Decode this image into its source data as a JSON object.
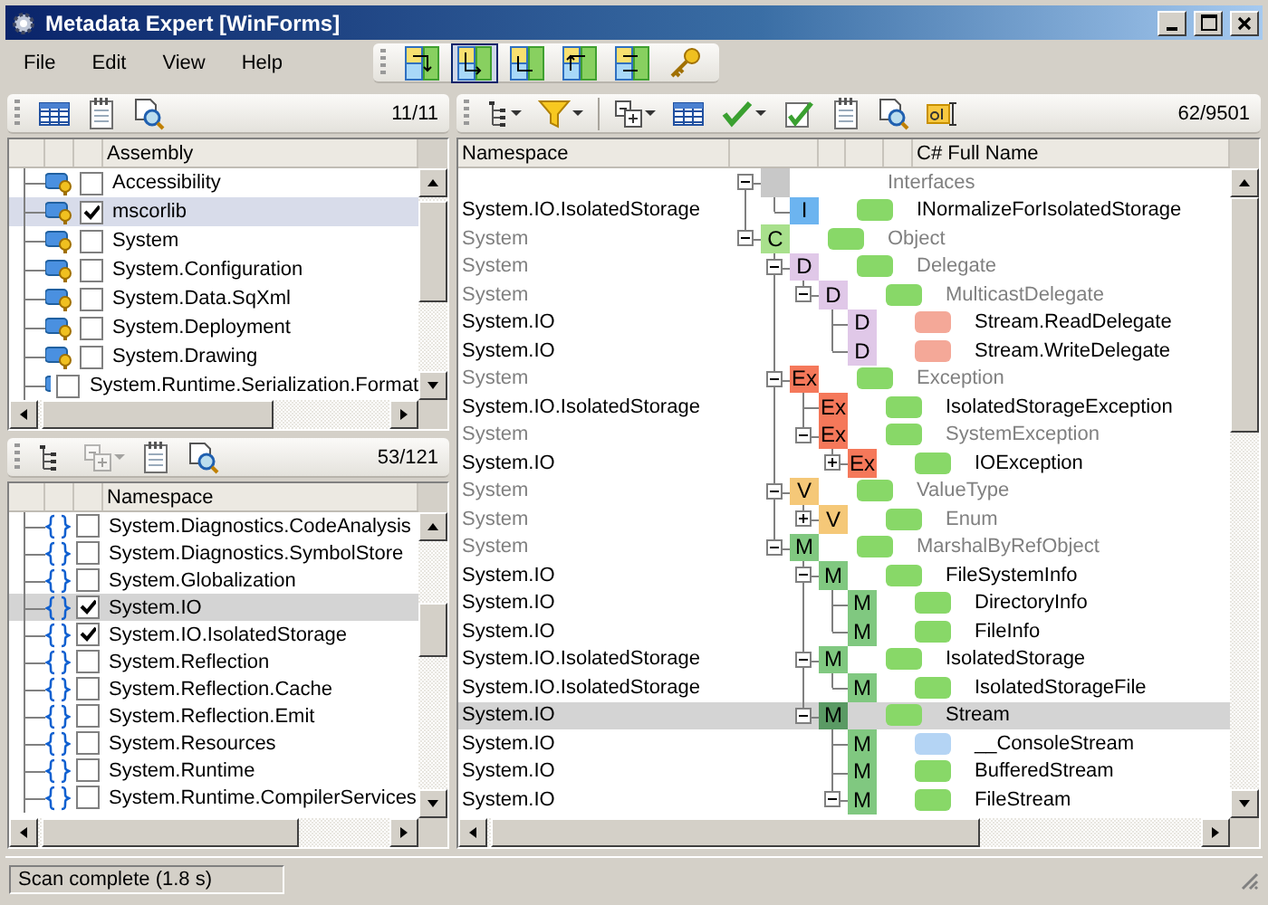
{
  "window": {
    "title": "Metadata Expert [WinForms]"
  },
  "menu": [
    "File",
    "Edit",
    "View",
    "Help"
  ],
  "layout_buttons": [
    {
      "selected": false
    },
    {
      "selected": true
    },
    {
      "selected": false
    },
    {
      "selected": false
    },
    {
      "selected": false
    }
  ],
  "assemblies": {
    "count": "11/11",
    "column": "Assembly",
    "items": [
      {
        "label": "Accessibility",
        "checked": false,
        "selected": false
      },
      {
        "label": "mscorlib",
        "checked": true,
        "selected": true
      },
      {
        "label": "System",
        "checked": false,
        "selected": false
      },
      {
        "label": "System.Configuration",
        "checked": false,
        "selected": false
      },
      {
        "label": "System.Data.SqXml",
        "checked": false,
        "selected": false
      },
      {
        "label": "System.Deployment",
        "checked": false,
        "selected": false
      },
      {
        "label": "System.Drawing",
        "checked": false,
        "selected": false
      },
      {
        "label": "System.Runtime.Serialization.Format",
        "checked": false,
        "selected": false
      }
    ]
  },
  "namespaces": {
    "count": "53/121",
    "column": "Namespace",
    "expand_disabled": true,
    "items": [
      {
        "label": "System.Diagnostics.CodeAnalysis",
        "checked": false,
        "selected": false
      },
      {
        "label": "System.Diagnostics.SymbolStore",
        "checked": false,
        "selected": false
      },
      {
        "label": "System.Globalization",
        "checked": false,
        "selected": false
      },
      {
        "label": "System.IO",
        "checked": true,
        "selected": true
      },
      {
        "label": "System.IO.IsolatedStorage",
        "checked": true,
        "selected": false
      },
      {
        "label": "System.Reflection",
        "checked": false,
        "selected": false
      },
      {
        "label": "System.Reflection.Cache",
        "checked": false,
        "selected": false
      },
      {
        "label": "System.Reflection.Emit",
        "checked": false,
        "selected": false
      },
      {
        "label": "System.Resources",
        "checked": false,
        "selected": false
      },
      {
        "label": "System.Runtime",
        "checked": false,
        "selected": false
      },
      {
        "label": "System.Runtime.CompilerServices",
        "checked": false,
        "selected": false
      }
    ]
  },
  "types": {
    "count": "62/9501",
    "columns": [
      "Namespace",
      "C# Full Name"
    ],
    "tree": [
      {
        "kind": "branch",
        "expanded": true,
        "badge": {
          "color": "#c8c8c8"
        },
        "name": "Interfaces",
        "dimmed": true,
        "selected": false,
        "children": [
          {
            "kind": "leaf",
            "namespace": "System.IO.IsolatedStorage",
            "badge": {
              "label": "I",
              "color": "#6cb4f0"
            },
            "marker": {
              "color": "#88d868"
            },
            "name": "INormalizeForIsolatedStorage",
            "dimmed": false,
            "selected": false
          }
        ]
      },
      {
        "kind": "branch",
        "expanded": true,
        "namespace": "System",
        "badge": {
          "label": "C",
          "color": "#a8e08c"
        },
        "marker": {
          "color": "#88d868"
        },
        "name": "Object",
        "dimmed": true,
        "selected": false,
        "children": [
          {
            "kind": "branch",
            "expanded": true,
            "namespace": "System",
            "badge": {
              "label": "D",
              "color": "#e0c8e8"
            },
            "marker": {
              "color": "#88d868"
            },
            "name": "Delegate",
            "dimmed": true,
            "selected": false,
            "children": [
              {
                "kind": "branch",
                "expanded": true,
                "namespace": "System",
                "badge": {
                  "label": "D",
                  "color": "#e0c8e8"
                },
                "marker": {
                  "color": "#88d868"
                },
                "name": "MulticastDelegate",
                "dimmed": true,
                "selected": false,
                "children": [
                  {
                    "kind": "leaf",
                    "namespace": "System.IO",
                    "badge": {
                      "label": "D",
                      "color": "#e0c8e8"
                    },
                    "marker": {
                      "color": "#f4a898"
                    },
                    "name": "Stream.ReadDelegate",
                    "dimmed": false,
                    "selected": false
                  },
                  {
                    "kind": "leaf",
                    "namespace": "System.IO",
                    "badge": {
                      "label": "D",
                      "color": "#e0c8e8"
                    },
                    "marker": {
                      "color": "#f4a898"
                    },
                    "name": "Stream.WriteDelegate",
                    "dimmed": false,
                    "selected": false
                  }
                ]
              }
            ]
          },
          {
            "kind": "branch",
            "expanded": true,
            "namespace": "System",
            "badge": {
              "label": "Ex",
              "color": "#f5785a"
            },
            "marker": {
              "color": "#88d868"
            },
            "name": "Exception",
            "dimmed": true,
            "selected": false,
            "children": [
              {
                "kind": "leaf",
                "namespace": "System.IO.IsolatedStorage",
                "badge": {
                  "label": "Ex",
                  "color": "#f5785a"
                },
                "marker": {
                  "color": "#88d868"
                },
                "name": "IsolatedStorageException",
                "dimmed": false,
                "selected": false
              },
              {
                "kind": "branch",
                "expanded": true,
                "namespace": "System",
                "badge": {
                  "label": "Ex",
                  "color": "#f5785a"
                },
                "marker": {
                  "color": "#88d868"
                },
                "name": "SystemException",
                "dimmed": true,
                "selected": false,
                "children": [
                  {
                    "kind": "branch",
                    "expanded": false,
                    "namespace": "System.IO",
                    "badge": {
                      "label": "Ex",
                      "color": "#f5785a"
                    },
                    "marker": {
                      "color": "#88d868"
                    },
                    "name": "IOException",
                    "dimmed": false,
                    "selected": false
                  }
                ]
              }
            ]
          },
          {
            "kind": "branch",
            "expanded": true,
            "namespace": "System",
            "badge": {
              "label": "V",
              "color": "#f5c878"
            },
            "marker": {
              "color": "#88d868"
            },
            "name": "ValueType",
            "dimmed": true,
            "selected": false,
            "children": [
              {
                "kind": "branch",
                "expanded": false,
                "namespace": "System",
                "badge": {
                  "label": "V",
                  "color": "#f5c878"
                },
                "marker": {
                  "color": "#88d868"
                },
                "name": "Enum",
                "dimmed": true,
                "selected": false
              }
            ]
          },
          {
            "kind": "branch",
            "expanded": true,
            "namespace": "System",
            "badge": {
              "label": "M",
              "color": "#80c880"
            },
            "marker": {
              "color": "#88d868"
            },
            "name": "MarshalByRefObject",
            "dimmed": true,
            "selected": false,
            "children": [
              {
                "kind": "branch",
                "expanded": true,
                "namespace": "System.IO",
                "badge": {
                  "label": "M",
                  "color": "#80c880"
                },
                "marker": {
                  "color": "#88d868"
                },
                "name": "FileSystemInfo",
                "dimmed": false,
                "selected": false,
                "children": [
                  {
                    "kind": "leaf",
                    "namespace": "System.IO",
                    "badge": {
                      "label": "M",
                      "color": "#80c880"
                    },
                    "marker": {
                      "color": "#88d868"
                    },
                    "name": "DirectoryInfo",
                    "dimmed": false,
                    "selected": false
                  },
                  {
                    "kind": "leaf",
                    "namespace": "System.IO",
                    "badge": {
                      "label": "M",
                      "color": "#80c880"
                    },
                    "marker": {
                      "color": "#88d868"
                    },
                    "name": "FileInfo",
                    "dimmed": false,
                    "selected": false
                  }
                ]
              },
              {
                "kind": "branch",
                "expanded": true,
                "namespace": "System.IO.IsolatedStorage",
                "badge": {
                  "label": "M",
                  "color": "#80c880"
                },
                "marker": {
                  "color": "#88d868"
                },
                "name": "IsolatedStorage",
                "dimmed": false,
                "selected": false,
                "children": [
                  {
                    "kind": "leaf",
                    "namespace": "System.IO.IsolatedStorage",
                    "badge": {
                      "label": "M",
                      "color": "#80c880"
                    },
                    "marker": {
                      "color": "#88d868"
                    },
                    "name": "IsolatedStorageFile",
                    "dimmed": false,
                    "selected": false
                  }
                ]
              },
              {
                "kind": "branch",
                "expanded": true,
                "namespace": "System.IO",
                "badge": {
                  "label": "M",
                  "color": "#5a9a64"
                },
                "marker": {
                  "color": "#88d868"
                },
                "name": "Stream",
                "dimmed": false,
                "selected": true,
                "children": [
                  {
                    "kind": "leaf",
                    "namespace": "System.IO",
                    "badge": {
                      "label": "M",
                      "color": "#80c880"
                    },
                    "marker": {
                      "color": "#b4d4f4"
                    },
                    "name": "__ConsoleStream",
                    "dimmed": false,
                    "selected": false
                  },
                  {
                    "kind": "leaf",
                    "namespace": "System.IO",
                    "badge": {
                      "label": "M",
                      "color": "#80c880"
                    },
                    "marker": {
                      "color": "#88d868"
                    },
                    "name": "BufferedStream",
                    "dimmed": false,
                    "selected": false
                  },
                  {
                    "kind": "branch",
                    "expanded": true,
                    "namespace": "System.IO",
                    "badge": {
                      "label": "M",
                      "color": "#80c880"
                    },
                    "marker": {
                      "color": "#88d868"
                    },
                    "name": "FileStream",
                    "dimmed": false,
                    "selected": false
                  }
                ]
              }
            ]
          }
        ]
      }
    ]
  },
  "status_bar": {
    "text": "Scan complete (1.8 s)"
  }
}
